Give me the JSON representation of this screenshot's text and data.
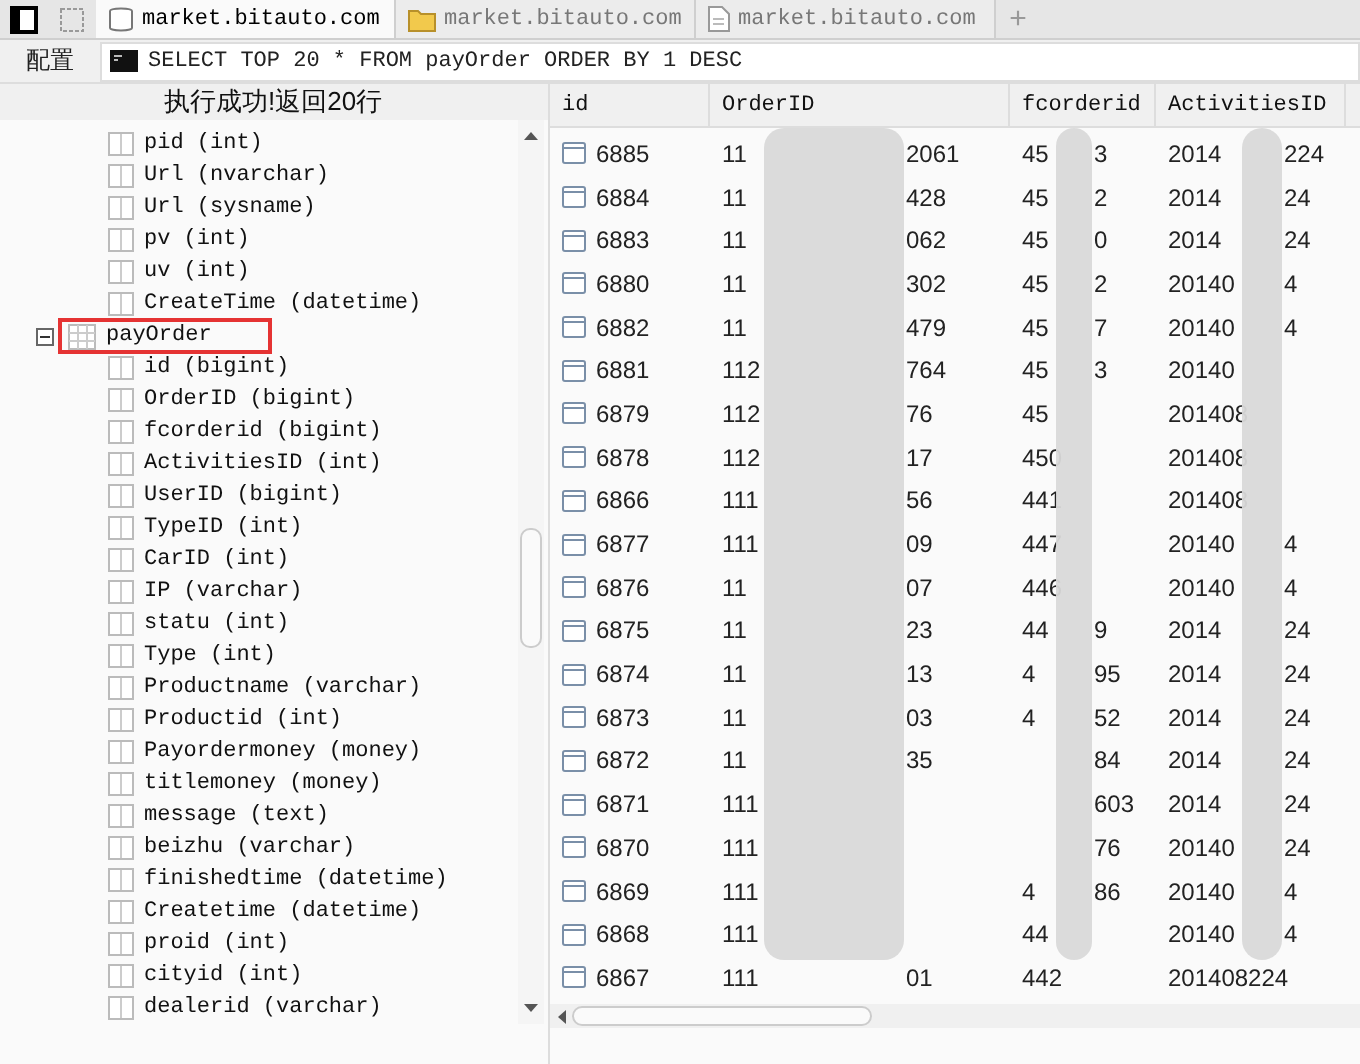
{
  "tabs": [
    {
      "label": "market.bitauto.com",
      "kind": "database",
      "selected": true
    },
    {
      "label": "market.bitauto.com",
      "kind": "folder",
      "selected": false
    },
    {
      "label": "market.bitauto.com",
      "kind": "file",
      "selected": false
    }
  ],
  "new_tab": "+",
  "config_label": "配置",
  "query": "SELECT TOP 20 * FROM payOrder ORDER BY 1 DESC",
  "status": "执行成功!返回20行",
  "tree": [
    {
      "name": "pid (int)"
    },
    {
      "name": "Url (nvarchar)"
    },
    {
      "name": "Url (sysname)"
    },
    {
      "name": "pv (int)"
    },
    {
      "name": "uv (int)"
    },
    {
      "name": "CreateTime (datetime)"
    }
  ],
  "table_node": {
    "name": "payOrder",
    "expanded": true,
    "marked": true,
    "children": [
      {
        "name": "id (bigint)"
      },
      {
        "name": "OrderID (bigint)"
      },
      {
        "name": "fcorderid (bigint)"
      },
      {
        "name": "ActivitiesID (int)"
      },
      {
        "name": "UserID (bigint)"
      },
      {
        "name": "TypeID (int)"
      },
      {
        "name": "CarID (int)"
      },
      {
        "name": "IP (varchar)"
      },
      {
        "name": "statu (int)"
      },
      {
        "name": "Type (int)"
      },
      {
        "name": "Productname (varchar)"
      },
      {
        "name": "Productid (int)"
      },
      {
        "name": "Payordermoney (money)"
      },
      {
        "name": "titlemoney (money)"
      },
      {
        "name": "message (text)"
      },
      {
        "name": "beizhu (varchar)"
      },
      {
        "name": "finishedtime (datetime)"
      },
      {
        "name": "Createtime (datetime)"
      },
      {
        "name": "proid (int)"
      },
      {
        "name": "cityid (int)"
      },
      {
        "name": "dealerid (varchar)"
      }
    ]
  },
  "columns": [
    "id",
    "OrderID",
    "fcorderid",
    "ActivitiesID"
  ],
  "rows": [
    {
      "id": "6885",
      "order": {
        "start": "11",
        "end": "2061"
      },
      "fc": {
        "start": "45",
        "end": "3"
      },
      "act": {
        "start": "2014",
        "end": "224"
      }
    },
    {
      "id": "6884",
      "order": {
        "start": "11",
        "end": "428"
      },
      "fc": {
        "start": "45",
        "end": "2"
      },
      "act": {
        "start": "2014",
        "end": "24"
      }
    },
    {
      "id": "6883",
      "order": {
        "start": "11",
        "end": "062"
      },
      "fc": {
        "start": "45",
        "end": "0"
      },
      "act": {
        "start": "2014",
        "end": "24"
      }
    },
    {
      "id": "6880",
      "order": {
        "start": "11",
        "end": "302"
      },
      "fc": {
        "start": "45",
        "end": "2"
      },
      "act": {
        "start": "20140",
        "end": "4"
      }
    },
    {
      "id": "6882",
      "order": {
        "start": "11",
        "end": "479"
      },
      "fc": {
        "start": "45",
        "end": "7"
      },
      "act": {
        "start": "20140",
        "end": "4"
      }
    },
    {
      "id": "6881",
      "order": {
        "start": "112",
        "end": "764"
      },
      "fc": {
        "start": "45",
        "end": "3"
      },
      "act": {
        "start": "20140"
      }
    },
    {
      "id": "6879",
      "order": {
        "start": "112",
        "end": "76"
      },
      "fc": {
        "start": "45"
      },
      "act": {
        "start": "201408"
      }
    },
    {
      "id": "6878",
      "order": {
        "start": "112",
        "end": "17"
      },
      "fc": {
        "start": "450"
      },
      "act": {
        "start": "201408"
      }
    },
    {
      "id": "6866",
      "order": {
        "start": "111",
        "end": "56"
      },
      "fc": {
        "start": "441"
      },
      "act": {
        "start": "201408"
      }
    },
    {
      "id": "6877",
      "order": {
        "start": "111",
        "end": "09"
      },
      "fc": {
        "start": "447"
      },
      "act": {
        "start": "20140",
        "end": "4"
      }
    },
    {
      "id": "6876",
      "order": {
        "start": "11",
        "end": "07"
      },
      "fc": {
        "start": "446"
      },
      "act": {
        "start": "20140",
        "end": "4"
      }
    },
    {
      "id": "6875",
      "order": {
        "start": "11",
        "end": "23"
      },
      "fc": {
        "start": "44",
        "end": "9"
      },
      "act": {
        "start": "2014",
        "end": "24"
      }
    },
    {
      "id": "6874",
      "order": {
        "start": "11",
        "end": "13"
      },
      "fc": {
        "start": "4",
        "end": "95"
      },
      "act": {
        "start": "2014",
        "end": "24"
      }
    },
    {
      "id": "6873",
      "order": {
        "start": "11",
        "end": "03"
      },
      "fc": {
        "start": "4",
        "end": "52"
      },
      "act": {
        "start": "2014",
        "end": "24"
      }
    },
    {
      "id": "6872",
      "order": {
        "start": "11",
        "end": "35"
      },
      "fc": {
        "end": "84"
      },
      "act": {
        "start": "2014",
        "end": "24"
      }
    },
    {
      "id": "6871",
      "order": {
        "start": "111"
      },
      "fc": {
        "end": "603"
      },
      "act": {
        "start": "2014",
        "end": "24"
      }
    },
    {
      "id": "6870",
      "order": {
        "start": "111"
      },
      "fc": {
        "end": "76"
      },
      "act": {
        "start": "20140",
        "end": "24"
      }
    },
    {
      "id": "6869",
      "order": {
        "start": "111"
      },
      "fc": {
        "start": "4",
        "end": "86"
      },
      "act": {
        "start": "20140",
        "end": "4"
      }
    },
    {
      "id": "6868",
      "order": {
        "start": "111"
      },
      "fc": {
        "start": "44"
      },
      "act": {
        "start": "20140",
        "end": "4"
      }
    },
    {
      "id": "6867",
      "order": {
        "start": "111",
        "end": "01"
      },
      "fc": {
        "start": "442"
      },
      "act": {
        "start": "201408224"
      }
    }
  ]
}
